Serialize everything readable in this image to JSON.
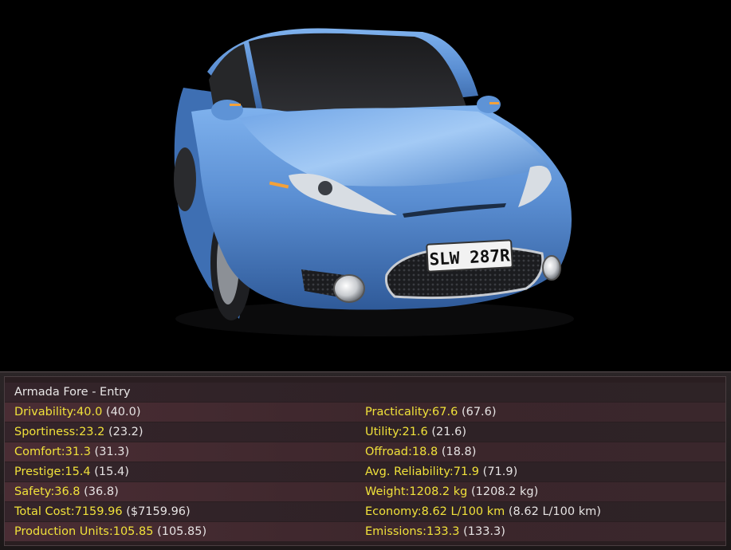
{
  "vehicle": {
    "title": "Armada Fore - Entry",
    "license_plate": "SLW 287R",
    "body_color": "#5b8fd3"
  },
  "stats_left": [
    {
      "label": "Drivability:",
      "value": "40.0",
      "paren": "(40.0)"
    },
    {
      "label": "Sportiness:",
      "value": "23.2",
      "paren": "(23.2)"
    },
    {
      "label": "Comfort:",
      "value": "31.3",
      "paren": "(31.3)"
    },
    {
      "label": "Prestige:",
      "value": "15.4",
      "paren": "(15.4)"
    },
    {
      "label": "Safety:",
      "value": "36.8",
      "paren": "(36.8)"
    },
    {
      "label": "Total Cost:",
      "value": "7159.96",
      "paren": "($7159.96)"
    },
    {
      "label": "Production Units:",
      "value": "105.85",
      "paren": "(105.85)"
    }
  ],
  "stats_right": [
    {
      "label": "Practicality:",
      "value": "67.6",
      "paren": "(67.6)"
    },
    {
      "label": "Utility:",
      "value": "21.6",
      "paren": "(21.6)"
    },
    {
      "label": "Offroad:",
      "value": "18.8",
      "paren": "(18.8)"
    },
    {
      "label": "Avg. Reliability:",
      "value": "71.9",
      "paren": "(71.9)"
    },
    {
      "label": "Weight:",
      "value": "1208.2 kg",
      "paren": "(1208.2 kg)"
    },
    {
      "label": "Economy:",
      "value": "8.62 L/100 km",
      "paren": "(8.62 L/100 km)"
    },
    {
      "label": "Emissions:",
      "value": "133.3",
      "paren": "(133.3)"
    }
  ],
  "colors": {
    "stat_label": "#f0e13a",
    "stat_paren": "#e6e3e3",
    "panel_bg": "#2a1e21"
  }
}
